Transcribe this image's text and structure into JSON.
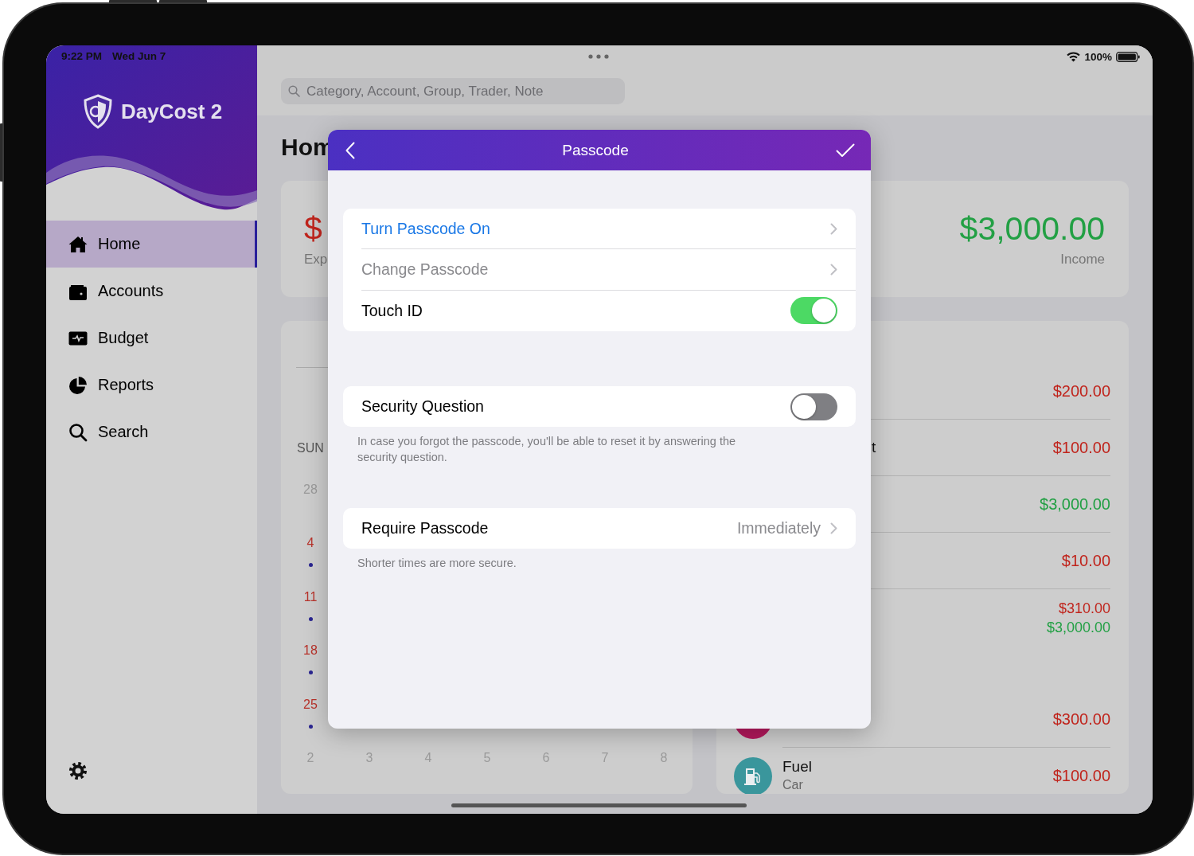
{
  "status_bar": {
    "time": "9:22 PM",
    "date": "Wed Jun 7",
    "battery_percent": "100%"
  },
  "sidebar": {
    "app_name": "DayCost 2",
    "items": [
      {
        "label": "Home",
        "selected": true
      },
      {
        "label": "Accounts",
        "selected": false
      },
      {
        "label": "Budget",
        "selected": false
      },
      {
        "label": "Reports",
        "selected": false
      },
      {
        "label": "Search",
        "selected": false
      }
    ]
  },
  "search": {
    "placeholder": "Category, Account, Group, Trader, Note"
  },
  "page_title": "Hom",
  "summary": {
    "expense_amount": "$",
    "expense_label": "Exp",
    "income_amount": "$3,000.00",
    "income_label": "Income"
  },
  "calendar": {
    "weekdays": [
      "SUN"
    ],
    "sunday_days": [
      {
        "day": "28",
        "muted": true,
        "dot": false
      },
      {
        "day": "4",
        "muted": false,
        "dot": true
      },
      {
        "day": "11",
        "muted": false,
        "dot": true
      },
      {
        "day": "18",
        "muted": false,
        "dot": true
      },
      {
        "day": "25",
        "muted": false,
        "dot": true
      }
    ],
    "last_row": [
      {
        "day": "2",
        "muted": true
      },
      {
        "day": "3",
        "muted": true
      },
      {
        "day": "4",
        "muted": true
      },
      {
        "day": "5",
        "muted": true
      },
      {
        "day": "6",
        "muted": true
      },
      {
        "day": "7",
        "muted": true
      },
      {
        "day": "8",
        "muted": true
      }
    ]
  },
  "transactions": [
    {
      "kind": "transaction",
      "amounts": [
        {
          "text": "$200.00",
          "color": "#c0241c"
        }
      ]
    },
    {
      "kind": "transaction",
      "title": "t",
      "amounts": [
        {
          "text": "$100.00",
          "color": "#c0241c"
        }
      ]
    },
    {
      "kind": "transaction",
      "amounts": [
        {
          "text": "$3,000.00",
          "color": "#22a044"
        }
      ]
    },
    {
      "kind": "transaction",
      "amounts": [
        {
          "text": "$10.00",
          "color": "#c0241c"
        }
      ]
    },
    {
      "kind": "day_total",
      "amounts": [
        {
          "text": "$310.00",
          "color": "#c0241c"
        },
        {
          "text": "$3,000.00",
          "color": "#22a044"
        }
      ]
    },
    {
      "kind": "transaction",
      "icon": {
        "kind": "category"
      },
      "amounts": [
        {
          "text": "$300.00",
          "color": "#c0241c"
        }
      ]
    },
    {
      "kind": "transaction",
      "icon": {
        "kind": "fuel",
        "color": "#3a969c"
      },
      "title": "Fuel",
      "subtitle": "Car",
      "amounts": [
        {
          "text": "$100.00",
          "color": "#c0241c"
        }
      ]
    }
  ],
  "modal": {
    "title": "Passcode",
    "groups": [
      {
        "rows": [
          {
            "kind": "link",
            "label": "Turn Passcode On",
            "disabled": false
          },
          {
            "kind": "link",
            "label": "Change Passcode",
            "disabled": true
          },
          {
            "kind": "toggle",
            "label": "Touch ID",
            "on": true
          }
        ]
      },
      {
        "rows": [
          {
            "kind": "toggle",
            "label": "Security Question",
            "on": false
          }
        ],
        "footer": "In case you forgot the passcode, you'll be able to reset it by answering the security question."
      },
      {
        "rows": [
          {
            "kind": "value",
            "label": "Require Passcode",
            "value": "Immediately"
          }
        ],
        "footer": "Shorter times are more secure."
      }
    ]
  }
}
